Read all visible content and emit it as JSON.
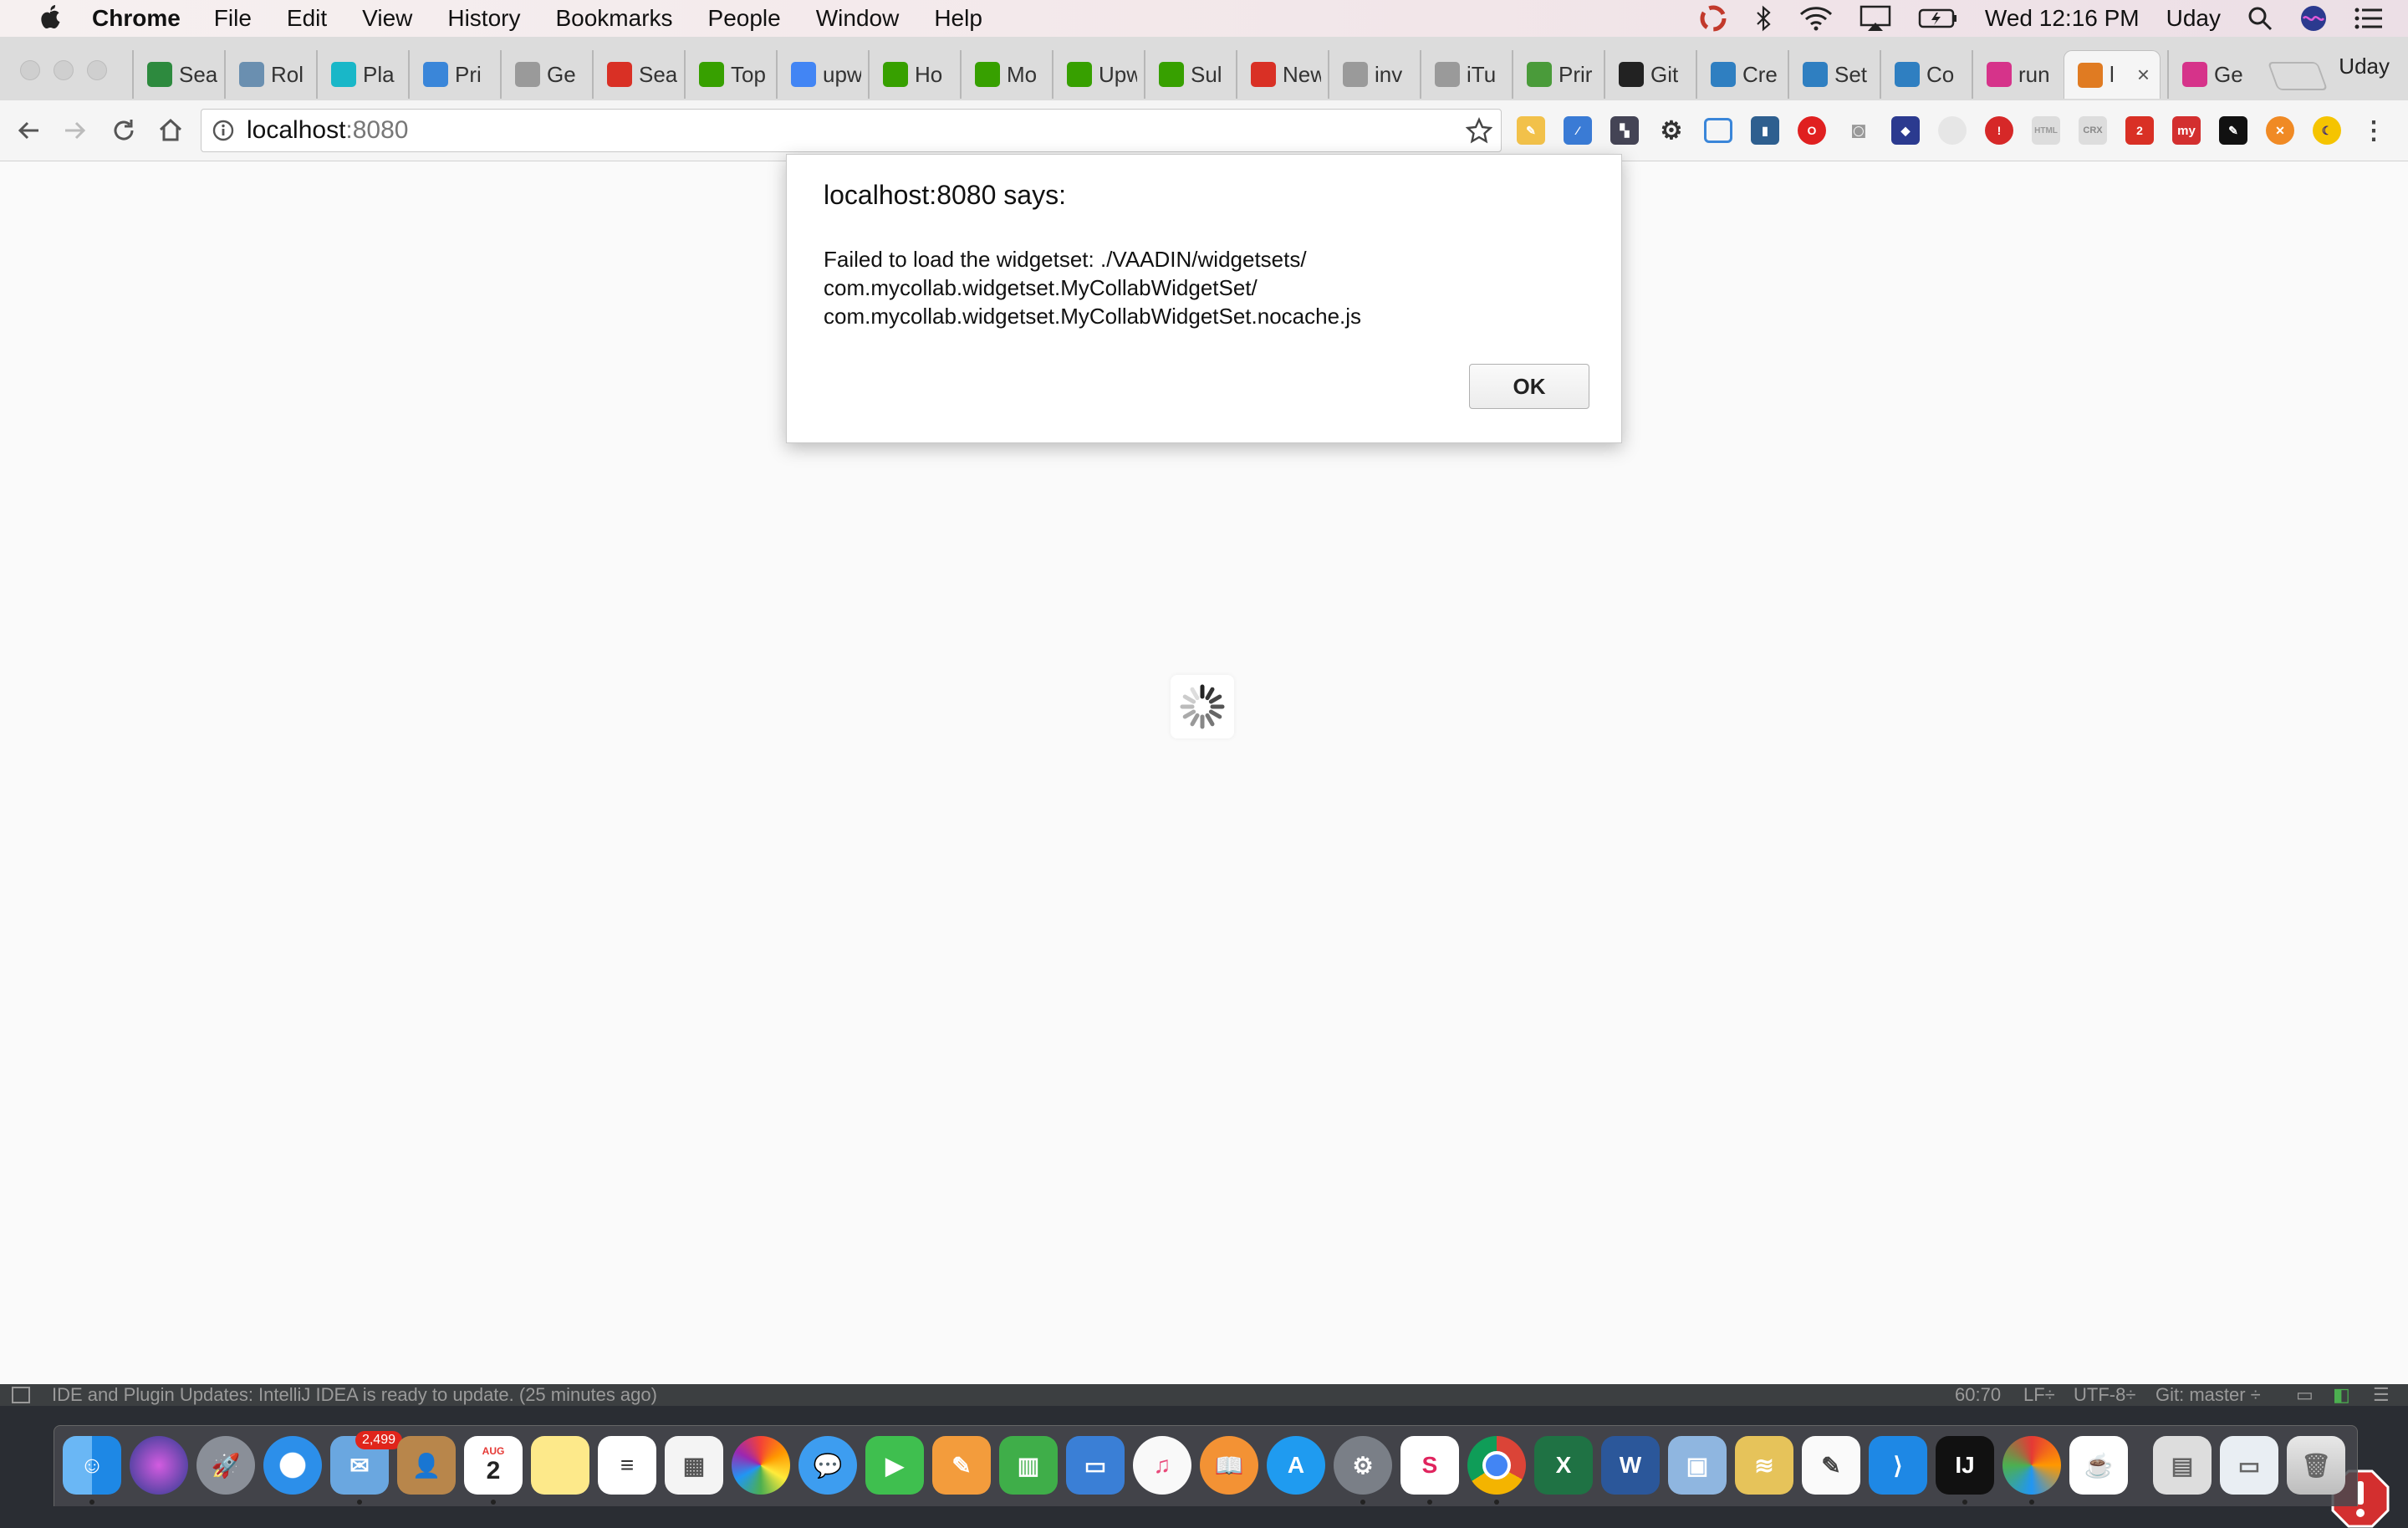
{
  "menubar": {
    "app_name": "Chrome",
    "menus": [
      "File",
      "Edit",
      "View",
      "History",
      "Bookmarks",
      "People",
      "Window",
      "Help"
    ],
    "clock": "Wed 12:16 PM",
    "user": "Uday"
  },
  "tabs": [
    {
      "label": "Sea",
      "icon": "google-drive-icon",
      "color": "#2d8a3e"
    },
    {
      "label": "Rol",
      "icon": "tools-icon",
      "color": "#6a8fb0"
    },
    {
      "label": "Pla",
      "icon": "play-circle-icon",
      "color": "#19b7c8"
    },
    {
      "label": "Pri",
      "icon": "pp-icon",
      "color": "#3a86d9"
    },
    {
      "label": "Ge",
      "icon": "document-icon",
      "color": "#9a9a9a"
    },
    {
      "label": "Sea",
      "icon": "gmail-icon",
      "color": "#d93025"
    },
    {
      "label": "Top",
      "icon": "upwork-icon",
      "color": "#37a000"
    },
    {
      "label": "upw",
      "icon": "google-icon",
      "color": "#4285f4"
    },
    {
      "label": "Ho",
      "icon": "upwork-icon",
      "color": "#37a000"
    },
    {
      "label": "Mo",
      "icon": "upwork-icon",
      "color": "#37a000"
    },
    {
      "label": "Upw",
      "icon": "upwork-icon",
      "color": "#37a000"
    },
    {
      "label": "Sul",
      "icon": "upwork-icon",
      "color": "#37a000"
    },
    {
      "label": "New",
      "icon": "gmail-icon",
      "color": "#d93025"
    },
    {
      "label": "inv",
      "icon": "document-icon",
      "color": "#9a9a9a"
    },
    {
      "label": "iTu",
      "icon": "document-icon",
      "color": "#9a9a9a"
    },
    {
      "label": "Prir",
      "icon": "play-icon",
      "color": "#4a9b3a"
    },
    {
      "label": "Git",
      "icon": "github-icon",
      "color": "#222222"
    },
    {
      "label": "Cre",
      "icon": "mycollab-icon",
      "color": "#2f7fc1"
    },
    {
      "label": "Set",
      "icon": "mycollab-icon",
      "color": "#2f7fc1"
    },
    {
      "label": "Co",
      "icon": "mycollab-icon",
      "color": "#2f7fc1"
    },
    {
      "label": "run",
      "icon": "ue-icon",
      "color": "#d6338a"
    },
    {
      "label": "l",
      "icon": "mycollab-icon",
      "color": "#e07b22",
      "active": true
    },
    {
      "label": "Ge",
      "icon": "ue-icon",
      "color": "#d6338a"
    }
  ],
  "toolbar": {
    "url_host": "localhost",
    "url_port": ":8080"
  },
  "dialog": {
    "title": "localhost:8080 says:",
    "line1": "Failed to load the widgetset: ./VAADIN/widgetsets/",
    "line2": "com.mycollab.widgetset.MyCollabWidgetSet/",
    "line3": "com.mycollab.widgetset.MyCollabWidgetSet.nocache.js",
    "ok_label": "OK"
  },
  "ide_status": {
    "message": "IDE and Plugin Updates: IntelliJ IDEA is ready to update. (25 minutes ago)",
    "position": "60:70",
    "line_sep": "LF÷",
    "encoding": "UTF-8÷",
    "git": "Git: master ÷"
  },
  "dock": {
    "mail_badge": "2,499",
    "calendar_month": "AUG",
    "calendar_day": "2"
  },
  "colors": {
    "menubar_bg": "#f3e9ec",
    "tabstrip_bg": "#dcdcdc",
    "page_bg": "#fafafa",
    "ide_bar_bg": "#3c3f41",
    "alert_red": "#d32f2f"
  }
}
